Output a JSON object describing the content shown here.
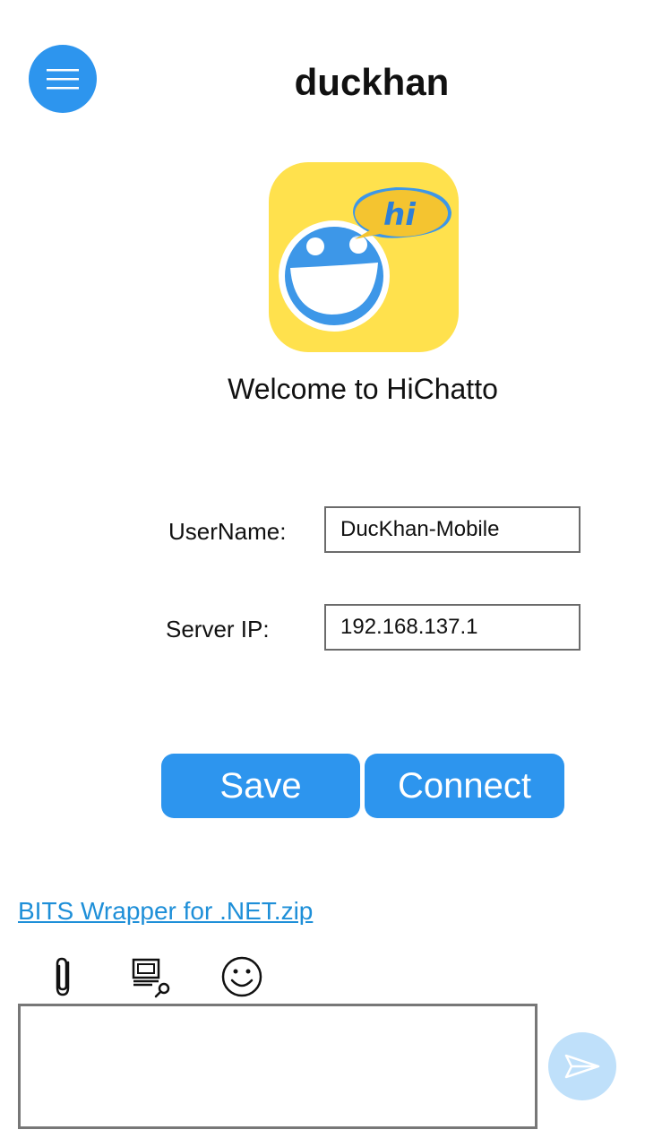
{
  "header": {
    "title": "duckhan",
    "menu_icon": "hamburger-menu-icon"
  },
  "brand": {
    "logo_icon": "hichatto-logo-icon",
    "logo_text": "hi",
    "welcome_text": "Welcome to HiChatto"
  },
  "form": {
    "username_label": "UserName:",
    "username_value": "DucKhan-Mobile",
    "server_ip_label": "Server IP:",
    "server_ip_value": "192.168.137.1"
  },
  "actions": {
    "save_label": "Save",
    "connect_label": "Connect"
  },
  "attachment": {
    "file_link": "BITS Wrapper for .NET.zip"
  },
  "composer": {
    "tools": [
      "attach-icon",
      "image-search-icon",
      "emoji-icon"
    ],
    "message_value": "",
    "send_icon": "send-icon"
  },
  "colors": {
    "accent": "#2d95ee",
    "send_disabled": "#bfe0fa",
    "link": "#1e8fd8",
    "logo_yellow": "#ffe14d",
    "logo_bubble": "#f4c430"
  }
}
